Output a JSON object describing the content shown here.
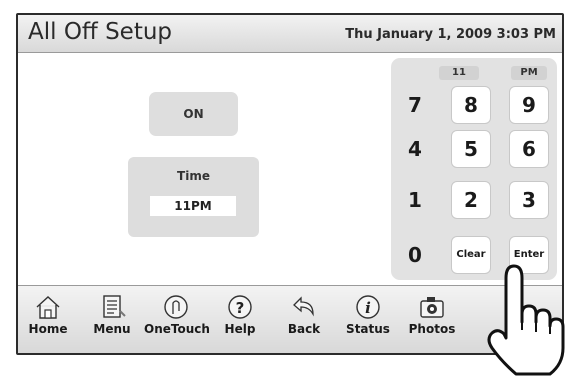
{
  "header": {
    "title": "All Off Setup",
    "datetime": "Thu January 1, 2009  3:03 PM"
  },
  "main": {
    "on_button": "ON",
    "time_label": "Time",
    "time_value": "11PM"
  },
  "keypad": {
    "display_hour": "11",
    "display_ampm": "PM",
    "keys": [
      "7",
      "8",
      "9",
      "4",
      "5",
      "6",
      "1",
      "2",
      "3",
      "0",
      "Clear",
      "Enter"
    ]
  },
  "toolbar": {
    "items": [
      {
        "label": "Home",
        "icon": "home-icon"
      },
      {
        "label": "Menu",
        "icon": "menu-icon"
      },
      {
        "label": "OneTouch",
        "icon": "onetouch-icon"
      },
      {
        "label": "Help",
        "icon": "help-icon"
      },
      {
        "label": "Back",
        "icon": "back-icon"
      },
      {
        "label": "Status",
        "icon": "status-icon"
      },
      {
        "label": "Photos",
        "icon": "camera-icon"
      }
    ]
  },
  "colors": {
    "panel": "#e2e2e2",
    "button": "#dedede",
    "border": "#2b2b2b"
  }
}
